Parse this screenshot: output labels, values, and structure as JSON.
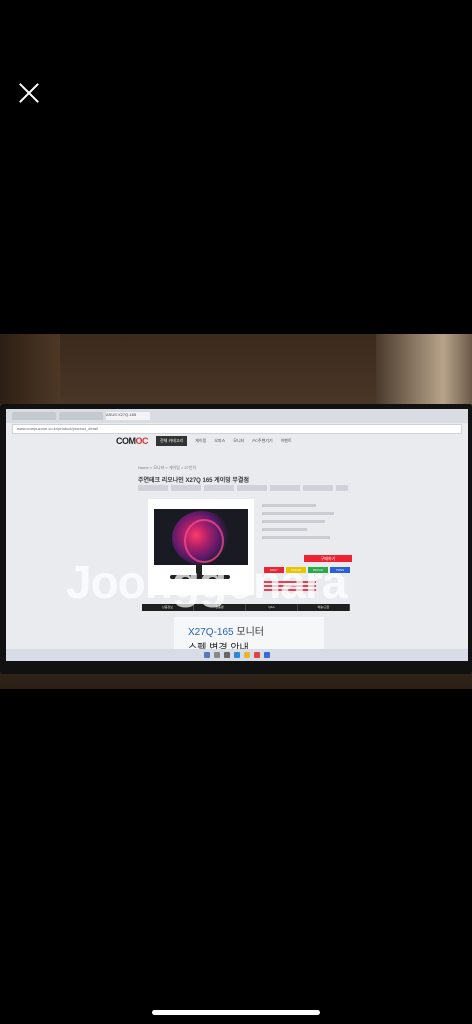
{
  "viewer": {
    "close_label": ""
  },
  "browser": {
    "tabs": [
      "",
      "",
      "ASUS X27Q-165"
    ],
    "address": "www.compuzone.co.kr/product/product_detail"
  },
  "site": {
    "logo_main": "COM",
    "logo_accent": "OC",
    "nav_button": "전체 카테고리",
    "nav_items": [
      "게이밍",
      "오피스",
      "모니터",
      "PC주변기기",
      "이벤트"
    ],
    "breadcrumb": "Home > 모니터 > 게이밍 > 27인치",
    "product_title": "주연테크 리오나인 X27Q 165 게이밍 무결점",
    "buy_label": "구매하기",
    "pay_options": [
      "NPAY",
      "KAKAO",
      "PAYCO",
      "TOSS"
    ],
    "detail_tabs": [
      "상품정보",
      "상품평",
      "Q&A",
      "배송/교환"
    ]
  },
  "banner": {
    "model": "X27Q-165",
    "model_suffix": " 모니터",
    "subtitle": "스펙 변경 안내"
  },
  "watermark": "Joonggonara",
  "colors": {
    "accent_red": "#e22233",
    "banner_blue": "#2a62b8"
  }
}
